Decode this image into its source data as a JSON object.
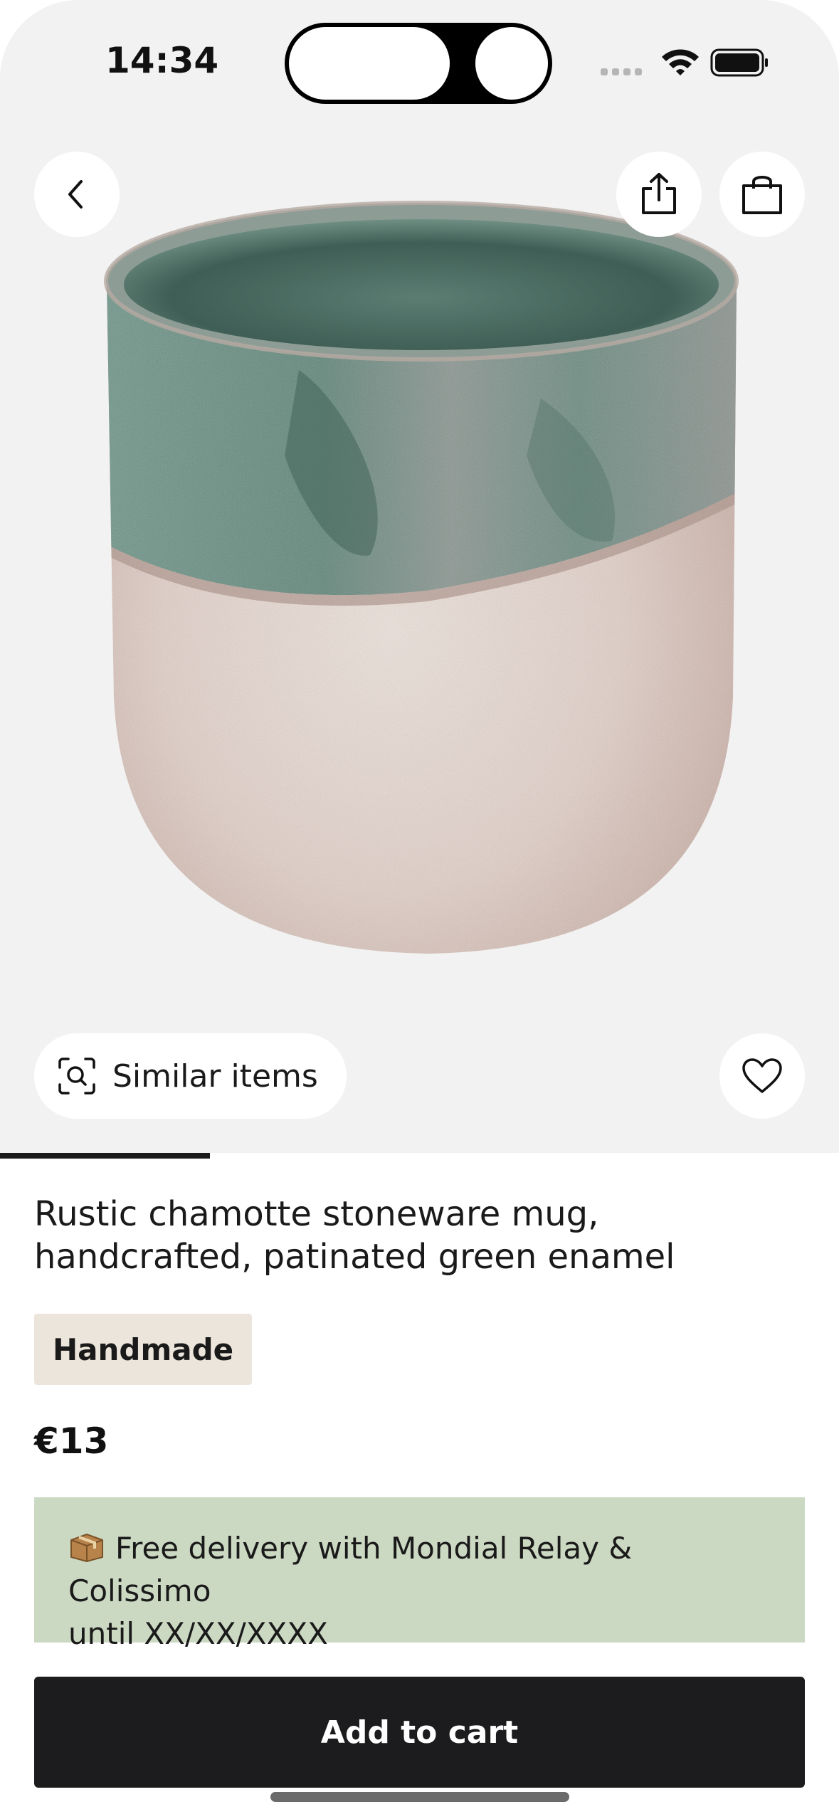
{
  "status_bar": {
    "time": "14:34"
  },
  "product": {
    "title_line1": "Rustic chamotte stoneware mug,",
    "title_line2": "handcrafted, patinated green enamel",
    "badge": "Handmade",
    "price": "€13",
    "image_description": "Ceramic mug with green glazed rim and speckled cream body"
  },
  "gallery": {
    "similar_items_label": "Similar items",
    "progress": 0.25
  },
  "delivery": {
    "icon": "package-icon",
    "line1": "Free delivery with Mondial Relay & Colissimo",
    "line2": "until XX/XX/XXXX"
  },
  "actions": {
    "add_to_cart_label": "Add to cart"
  },
  "icons": {
    "back": "chevron-left-icon",
    "share": "share-icon",
    "bag": "shopping-bag-icon",
    "similar": "visual-search-icon",
    "favorite": "heart-icon"
  },
  "colors": {
    "hero_background": "#f2f2f2",
    "badge_background": "#ebe5dc",
    "delivery_background": "#cbd8c2",
    "cta_background": "#1c1c1e",
    "cta_text": "#ffffff"
  }
}
